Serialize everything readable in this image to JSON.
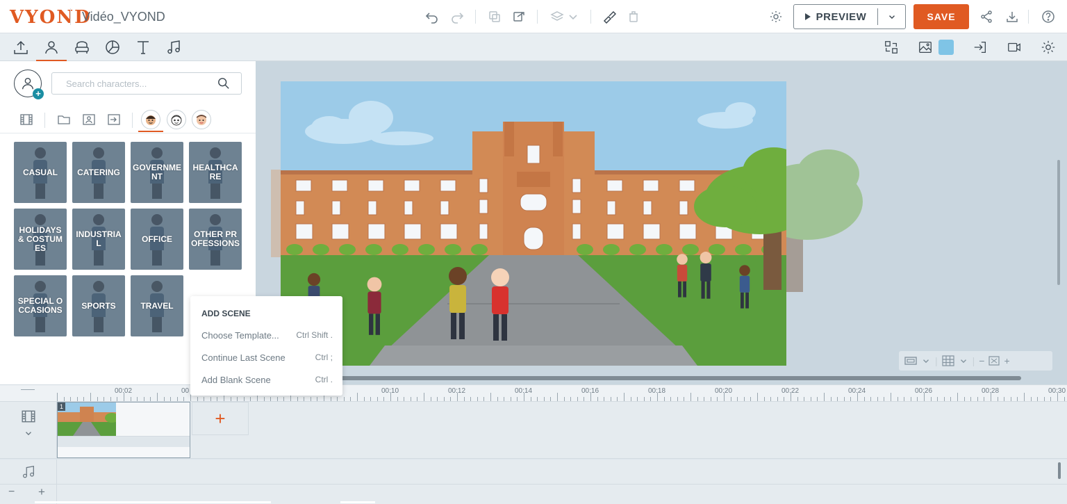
{
  "app": {
    "logo": "VYOND",
    "project_title": "Vidéo_VYOND"
  },
  "topbar": {
    "icons": [
      "undo-icon",
      "redo-icon",
      "copy-icon",
      "paste-icon",
      "layers-icon",
      "chevron-down-icon",
      "brush-icon",
      "trash-icon",
      "gear-icon"
    ],
    "preview_label": "PREVIEW",
    "save_label": "SAVE",
    "right_icons": [
      "share-icon",
      "download-icon",
      "help-icon"
    ]
  },
  "library_tabs": [
    "upload-icon",
    "character-icon",
    "prop-icon",
    "chart-icon",
    "text-icon",
    "music-icon"
  ],
  "active_library_tab": "character-icon",
  "subbar_right": [
    "swap-icon",
    "image-icon",
    "enter-icon",
    "camera-icon",
    "gear-icon"
  ],
  "colors": {
    "accent": "#e05a22",
    "teal": "#1b8ea3",
    "background_swatch": "#7fc4e6",
    "tile": "#6e8292"
  },
  "panel": {
    "search_placeholder": "Search characters...",
    "filter_icons": [
      "film-icon",
      "folder-icon",
      "character-folder-icon",
      "import-icon"
    ],
    "style_icons": [
      "style-contemporary-icon",
      "style-whiteboard-icon",
      "style-business-icon"
    ],
    "categories": [
      {
        "label": "CASUAL"
      },
      {
        "label": "CATERING"
      },
      {
        "label": "GOVERNMENT"
      },
      {
        "label": "HEALTHCARE"
      },
      {
        "label": "HOLIDAYS & COSTUMES"
      },
      {
        "label": "INDUSTRIAL"
      },
      {
        "label": "OFFICE"
      },
      {
        "label": "OTHER PROFESSIONS"
      },
      {
        "label": "SPECIAL OCCASIONS"
      },
      {
        "label": "SPORTS"
      },
      {
        "label": "TRAVEL"
      }
    ]
  },
  "context_menu": {
    "heading": "ADD SCENE",
    "items": [
      {
        "label": "Choose Template...",
        "shortcut": "Ctrl Shift ."
      },
      {
        "label": "Continue Last Scene",
        "shortcut": "Ctrl ;"
      },
      {
        "label": "Add Blank Scene",
        "shortcut": "Ctrl ."
      }
    ]
  },
  "timeline": {
    "labels": [
      "00:02",
      "00",
      "00:10",
      "00:12",
      "00:14",
      "00:16",
      "00:18",
      "00:20",
      "00:22",
      "00:24",
      "00:26",
      "00:28",
      "00:30"
    ],
    "scene_number": "1",
    "add_scene_symbol": "+",
    "zoom_minus": "−",
    "zoom_plus": "+"
  },
  "stage_controls": {
    "zoom_minus": "−",
    "zoom_plus": "+"
  }
}
